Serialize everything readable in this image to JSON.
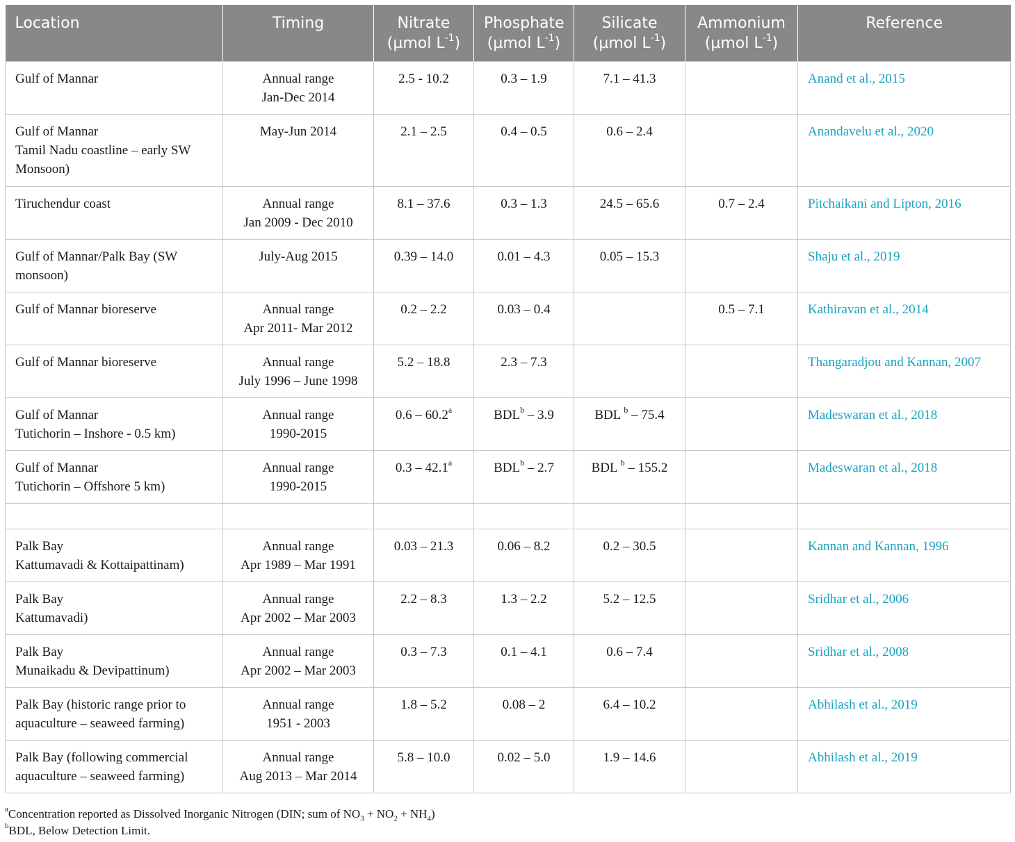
{
  "headers": {
    "location": "Location",
    "timing": "Timing",
    "nitrate_name": "Nitrate",
    "phosphate_name": "Phosphate",
    "silicate_name": "Silicate",
    "ammonium_name": "Ammonium",
    "unit_base": "(µmol L",
    "unit_exp": "-1",
    "unit_close": ")",
    "reference": "Reference"
  },
  "rows": [
    {
      "loc1": "Gulf of Mannar",
      "loc2": "",
      "tim1": "Annual range",
      "tim2": "Jan-Dec 2014",
      "nitrate": "2.5 - 10.2",
      "phosphate": "0.3 – 1.9",
      "silicate": "7.1 – 41.3",
      "ammonium": "",
      "reference": "Anand et al., 2015"
    },
    {
      "loc1": "Gulf of Mannar",
      "loc2": "Tamil Nadu coastline – early SW Monsoon)",
      "tim1": "May-Jun 2014",
      "tim2": "",
      "nitrate": "2.1 – 2.5",
      "phosphate": "0.4 – 0.5",
      "silicate": "0.6 – 2.4",
      "ammonium": "",
      "reference": "Anandavelu et al., 2020"
    },
    {
      "loc1": "Tiruchendur coast",
      "loc2": "",
      "tim1": "Annual range",
      "tim2": "Jan 2009 - Dec 2010",
      "nitrate": "8.1 – 37.6",
      "phosphate": "0.3 – 1.3",
      "silicate": "24.5 – 65.6",
      "ammonium": "0.7 – 2.4",
      "reference": "Pitchaikani and Lipton, 2016"
    },
    {
      "loc1": "Gulf of Mannar/Palk Bay (SW monsoon)",
      "loc2": "",
      "tim1": "July-Aug 2015",
      "tim2": "",
      "nitrate": "0.39 – 14.0",
      "phosphate": "0.01 – 4.3",
      "silicate": "0.05 – 15.3",
      "ammonium": "",
      "reference": "Shaju et al., 2019"
    },
    {
      "loc1": "Gulf of Mannar bioreserve",
      "loc2": "",
      "tim1": "Annual range",
      "tim2": "Apr 2011- Mar 2012",
      "nitrate": "0.2 – 2.2",
      "phosphate": "0.03 – 0.4",
      "silicate": "",
      "ammonium": "0.5 – 7.1",
      "reference": "Kathiravan et al., 2014"
    },
    {
      "loc1": "Gulf of Mannar bioreserve",
      "loc2": "",
      "tim1": "Annual range",
      "tim2": "July 1996 – June 1998",
      "nitrate": "5.2 – 18.8",
      "phosphate": "2.3 – 7.3",
      "silicate": "",
      "ammonium": "",
      "reference": "Thangaradjou and Kannan, 2007"
    },
    {
      "loc1": "Gulf of Mannar",
      "loc2": "Tutichorin – Inshore - 0.5 km)",
      "tim1": "Annual range",
      "tim2": "1990-2015",
      "nitrate": "0.6 – 60.2",
      "nitrate_sup": "a",
      "phosphate_pre": "BDL",
      "phosphate_sup": "b",
      "phosphate_post": " – 3.9",
      "silicate_pre": "BDL ",
      "silicate_sup": "b",
      "silicate_post": " – 75.4",
      "ammonium": "",
      "reference": "Madeswaran et al., 2018"
    },
    {
      "loc1": "Gulf of Mannar",
      "loc2": "Tutichorin – Offshore 5 km)",
      "tim1": "Annual range",
      "tim2": "1990-2015",
      "nitrate": "0.3 – 42.1",
      "nitrate_sup": "a",
      "phosphate_pre": "BDL",
      "phosphate_sup": "b",
      "phosphate_post": " – 2.7",
      "silicate_pre": "BDL ",
      "silicate_sup": "b",
      "silicate_post": " – 155.2",
      "ammonium": "",
      "reference": "Madeswaran et al., 2018"
    },
    {
      "loc1": "Palk Bay",
      "loc2": "Kattumavadi & Kottaipattinam)",
      "tim1": "Annual range",
      "tim2": "Apr 1989 – Mar 1991",
      "nitrate": "0.03 – 21.3",
      "phosphate": "0.06 – 8.2",
      "silicate": "0.2 – 30.5",
      "ammonium": "",
      "reference": "Kannan and Kannan, 1996"
    },
    {
      "loc1": "Palk Bay",
      "loc2": "Kattumavadi)",
      "tim1": "Annual range",
      "tim2": "Apr 2002 – Mar 2003",
      "nitrate": "2.2 – 8.3",
      "phosphate": "1.3 – 2.2",
      "silicate": "5.2 – 12.5",
      "ammonium": "",
      "reference": "Sridhar et al., 2006"
    },
    {
      "loc1": "Palk Bay",
      "loc2": "Munaikadu & Devipattinum)",
      "tim1": "Annual range",
      "tim2": "Apr 2002 – Mar 2003",
      "nitrate": "0.3 – 7.3",
      "phosphate": "0.1 – 4.1",
      "silicate": "0.6 – 7.4",
      "ammonium": "",
      "reference": "Sridhar et al., 2008"
    },
    {
      "loc1": "Palk Bay (historic range prior to aquaculture – seaweed farming)",
      "loc2": "",
      "tim1": "Annual range",
      "tim2": "1951 - 2003",
      "nitrate": "1.8 – 5.2",
      "phosphate": "0.08 – 2",
      "silicate": "6.4 – 10.2",
      "ammonium": "",
      "reference": "Abhilash et al., 2019"
    },
    {
      "loc1": "Palk Bay (following commercial aquaculture – seaweed farming)",
      "loc2": "",
      "tim1": "Annual range",
      "tim2": "Aug 2013 – Mar 2014",
      "nitrate": "5.8 – 10.0",
      "phosphate": "0.02 – 5.0",
      "silicate": "1.9 – 14.6",
      "ammonium": "",
      "reference": "Abhilash et al., 2019"
    }
  ],
  "footnotes": {
    "a_mark": "a",
    "a_text1": "Concentration reported as Dissolved Inorganic Nitrogen (DIN; sum of NO",
    "a_sub1": "3",
    "a_text2": " + NO",
    "a_sub2": "2",
    "a_text3": " + NH",
    "a_sub3": "4",
    "a_text4": ")",
    "b_mark": "b",
    "b_text": "BDL, Below Detection Limit."
  }
}
